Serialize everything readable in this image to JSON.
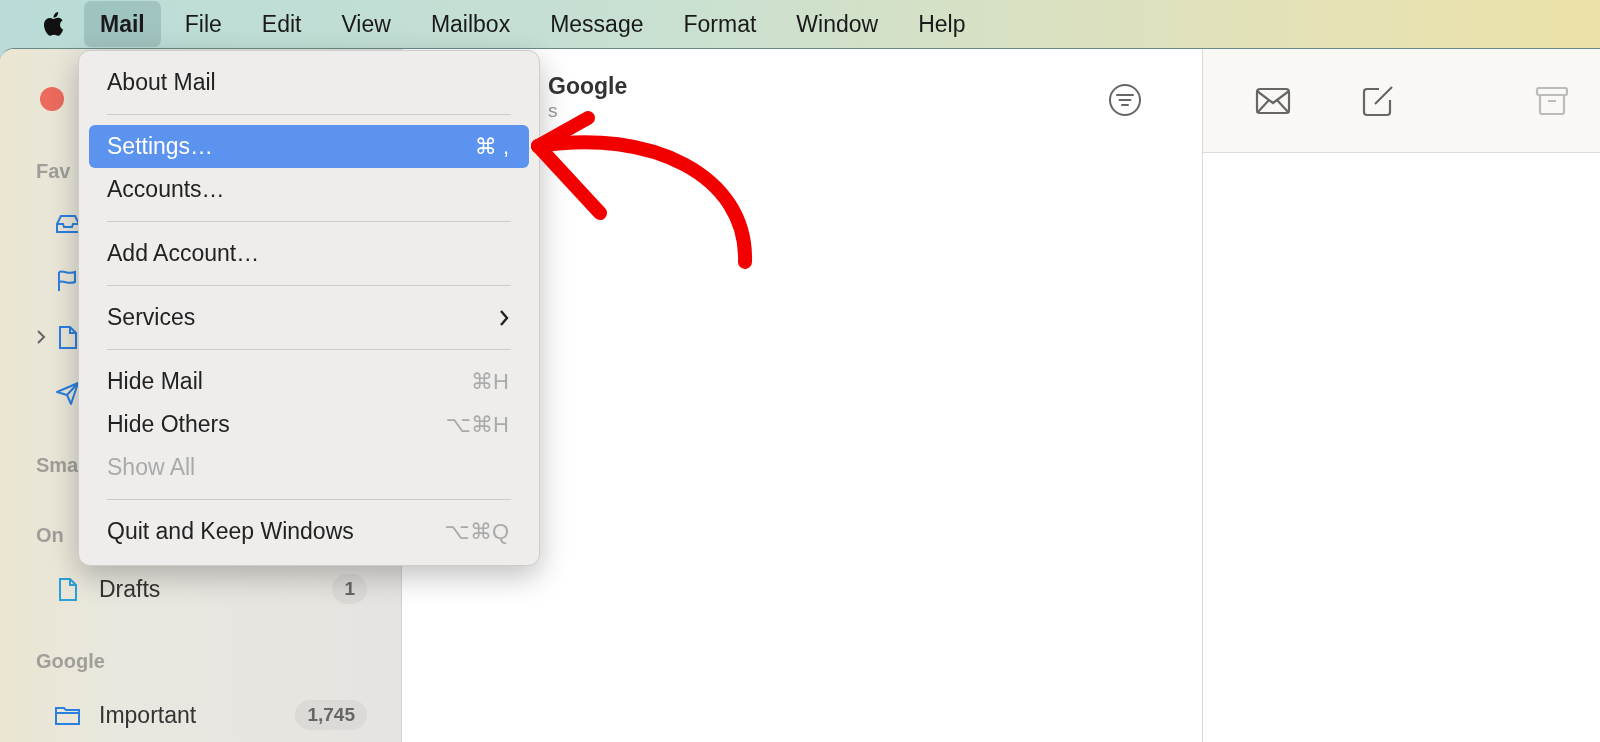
{
  "menu_bar": {
    "items": [
      {
        "label": "Mail",
        "selected": true
      },
      {
        "label": "File",
        "selected": false
      },
      {
        "label": "Edit",
        "selected": false
      },
      {
        "label": "View",
        "selected": false
      },
      {
        "label": "Mailbox",
        "selected": false
      },
      {
        "label": "Message",
        "selected": false
      },
      {
        "label": "Format",
        "selected": false
      },
      {
        "label": "Window",
        "selected": false
      },
      {
        "label": "Help",
        "selected": false
      }
    ]
  },
  "sidebar": {
    "sections": [
      {
        "title": "Fav",
        "items": [
          {
            "expandable": false
          },
          {
            "expandable": false
          },
          {
            "expandable": true
          },
          {
            "expandable": false
          }
        ]
      },
      {
        "title": "Sma"
      },
      {
        "title": "On",
        "items": [
          {
            "label": "Drafts",
            "count": "1",
            "expandable": false
          }
        ]
      },
      {
        "title": "Google",
        "items": [
          {
            "label": "Important",
            "count": "1,745",
            "expandable": false
          }
        ]
      }
    ]
  },
  "message_list": {
    "title": "Google",
    "subtitle": "s"
  },
  "mail_menu": {
    "items": [
      {
        "kind": "item",
        "label": "About Mail",
        "selected": false,
        "disabled": false
      },
      {
        "kind": "separator"
      },
      {
        "kind": "item",
        "label": "Settings…",
        "shortcut": "⌘ ,",
        "selected": true,
        "disabled": false
      },
      {
        "kind": "item",
        "label": "Accounts…",
        "selected": false,
        "disabled": false
      },
      {
        "kind": "separator"
      },
      {
        "kind": "item",
        "label": "Add Account…",
        "selected": false,
        "disabled": false
      },
      {
        "kind": "separator"
      },
      {
        "kind": "item",
        "label": "Services",
        "submenu": true,
        "selected": false,
        "disabled": false
      },
      {
        "kind": "separator"
      },
      {
        "kind": "item",
        "label": "Hide Mail",
        "shortcut": "⌘H",
        "selected": false,
        "disabled": false
      },
      {
        "kind": "item",
        "label": "Hide Others",
        "shortcut": "⌥⌘H",
        "selected": false,
        "disabled": false
      },
      {
        "kind": "item",
        "label": "Show All",
        "selected": false,
        "disabled": true
      },
      {
        "kind": "separator"
      },
      {
        "kind": "item",
        "label": "Quit and Keep Windows",
        "shortcut": "⌥⌘Q",
        "selected": false,
        "disabled": false
      }
    ]
  }
}
